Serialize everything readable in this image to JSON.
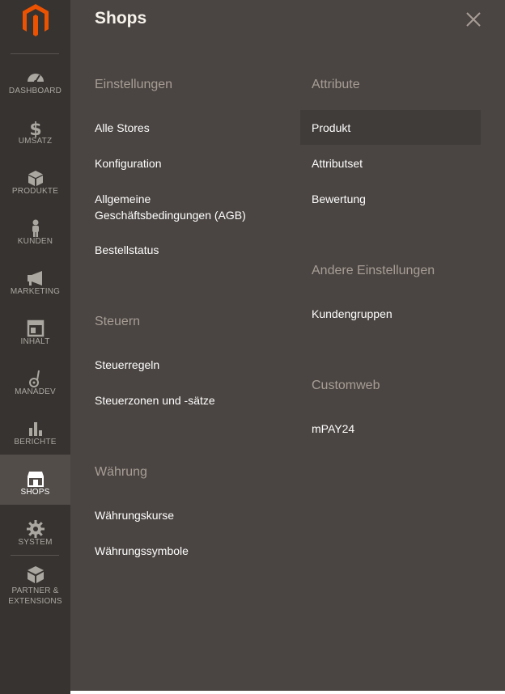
{
  "sidebar": {
    "logo_icon": "magento-logo",
    "items": [
      {
        "label": "DASHBOARD",
        "icon": "speedometer-icon"
      },
      {
        "label": "UMSATZ",
        "icon": "dollar-icon"
      },
      {
        "label": "PRODUKTE",
        "icon": "cube-icon"
      },
      {
        "label": "KUNDEN",
        "icon": "person-icon"
      },
      {
        "label": "MARKETING",
        "icon": "megaphone-icon"
      },
      {
        "label": "INHALT",
        "icon": "layout-icon"
      },
      {
        "label": "MANADEV",
        "icon": "manadev-icon"
      },
      {
        "label": "BERICHTE",
        "icon": "bar-chart-icon"
      },
      {
        "label": "SHOPS",
        "icon": "storefront-icon",
        "active": true
      },
      {
        "label": "SYSTEM",
        "icon": "gear-icon"
      },
      {
        "label": "PARTNER &",
        "label2": "EXTENSIONS",
        "icon": "box-icon"
      }
    ]
  },
  "panel": {
    "title": "Shops",
    "close_icon": "close-icon",
    "columns": [
      {
        "sections": [
          {
            "heading": "Einstellungen",
            "links": [
              "Alle Stores",
              "Konfiguration",
              "Allgemeine Geschäftsbedingungen (AGB)",
              "Bestellstatus"
            ]
          },
          {
            "heading": "Steuern",
            "links": [
              "Steuerregeln",
              "Steuerzonen und -sätze"
            ]
          },
          {
            "heading": "Währung",
            "links": [
              "Währungskurse",
              "Währungssymbole"
            ]
          }
        ]
      },
      {
        "sections": [
          {
            "heading": "Attribute",
            "links": [
              "Produkt",
              "Attributset",
              "Bewertung"
            ]
          },
          {
            "heading": "Andere Einstellungen",
            "links": [
              "Kundengruppen"
            ]
          },
          {
            "heading": "Customweb",
            "links": [
              "mPAY24"
            ]
          }
        ]
      }
    ]
  },
  "colors": {
    "sidebar_bg": "#373330",
    "panel_bg": "#4a4542",
    "accent_orange": "#eb5202",
    "heading": "#a79d95"
  }
}
